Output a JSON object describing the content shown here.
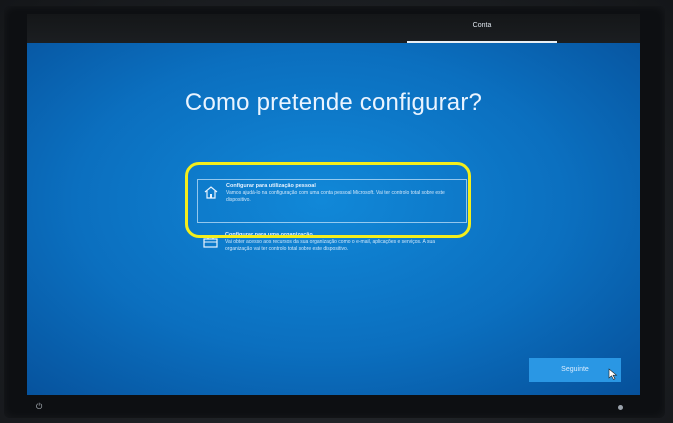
{
  "top_bar": {
    "tab_label": "Conta"
  },
  "main": {
    "title": "Como pretende configurar?",
    "options": [
      {
        "title": "Configurar para utilização pessoal",
        "description": "Vamos ajudá-lo na configuração com uma conta pessoal Microsoft. Vai ter controlo total sobre este dispositivo.",
        "icon": "home-icon",
        "selected": true
      },
      {
        "title": "Configurar para uma organização",
        "description": "Vai obter acesso aos recursos da sua organização como o e-mail, aplicações e serviços. A sua organização vai ter controlo total sobre este dispositivo.",
        "icon": "briefcase-icon",
        "selected": false
      }
    ]
  },
  "footer": {
    "next_label": "Seguinte"
  },
  "colors": {
    "oobe_blue": "#0b6fbf",
    "highlight": "#f3ee1c"
  }
}
